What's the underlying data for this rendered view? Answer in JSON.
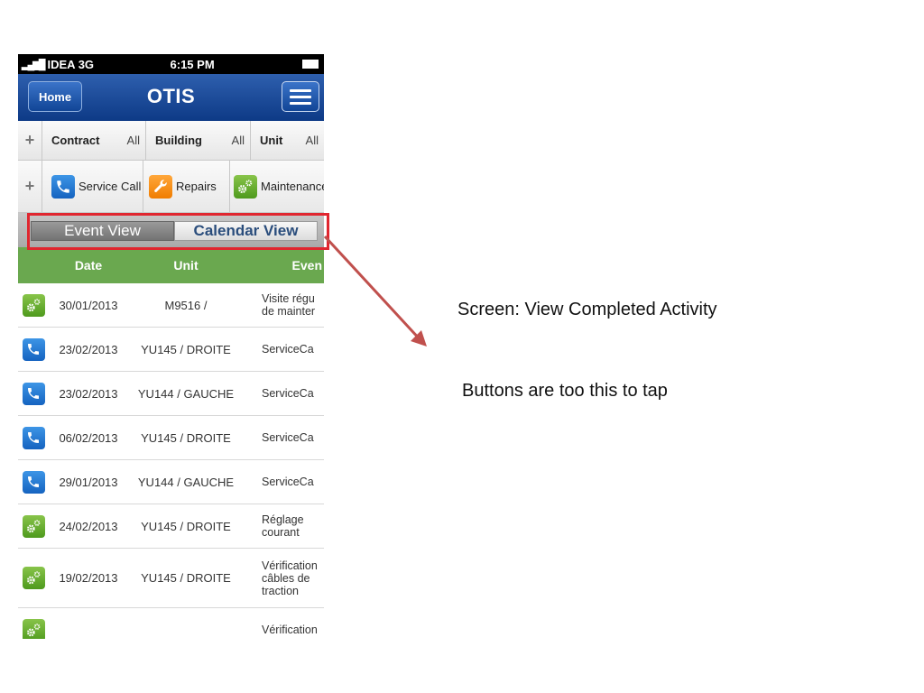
{
  "status_bar": {
    "carrier": "IDEA 3G",
    "time": "6:15 PM"
  },
  "navbar": {
    "home_label": "Home",
    "title": "OTIS"
  },
  "filters": [
    {
      "name": "Contract",
      "value": "All"
    },
    {
      "name": "Building",
      "value": "All"
    },
    {
      "name": "Unit",
      "value": "All"
    }
  ],
  "categories": [
    {
      "label": "Service Call",
      "icon": "phone-icon",
      "color": "#1f72d1"
    },
    {
      "label": "Repairs",
      "icon": "wrench-icon",
      "color": "#f7931e"
    },
    {
      "label": "Maintenance",
      "icon": "gears-icon",
      "color": "#5aa62a"
    }
  ],
  "segment": {
    "event_view": "Event View",
    "calendar_view": "Calendar View",
    "selected": "Event View"
  },
  "table": {
    "header_color": "#6aa84f",
    "columns": {
      "date": "Date",
      "unit": "Unit",
      "event": "Even"
    },
    "rows": [
      {
        "type": "maintenance",
        "date": "30/01/2013",
        "unit": "M9516 /",
        "event": "Visite régu de mainter"
      },
      {
        "type": "service",
        "date": "23/02/2013",
        "unit": "YU145 / DROITE",
        "event": "ServiceCa"
      },
      {
        "type": "service",
        "date": "23/02/2013",
        "unit": "YU144 / GAUCHE",
        "event": "ServiceCa"
      },
      {
        "type": "service",
        "date": "06/02/2013",
        "unit": "YU145 / DROITE",
        "event": "ServiceCa"
      },
      {
        "type": "service",
        "date": "29/01/2013",
        "unit": "YU144 / GAUCHE",
        "event": "ServiceCa"
      },
      {
        "type": "maintenance",
        "date": "24/02/2013",
        "unit": "YU145 / DROITE",
        "event": "Réglage courant"
      },
      {
        "type": "maintenance",
        "date": "19/02/2013",
        "unit": "YU145 / DROITE",
        "event": "Vérification câbles de traction"
      },
      {
        "type": "maintenance",
        "date": "",
        "unit": "",
        "event": "Vérification"
      }
    ]
  },
  "annotation": {
    "screen_label": "Screen: View Completed Activity",
    "note": "Buttons are too this to tap",
    "highlight_color": "#e0262f",
    "arrow_color": "#c0504d"
  }
}
